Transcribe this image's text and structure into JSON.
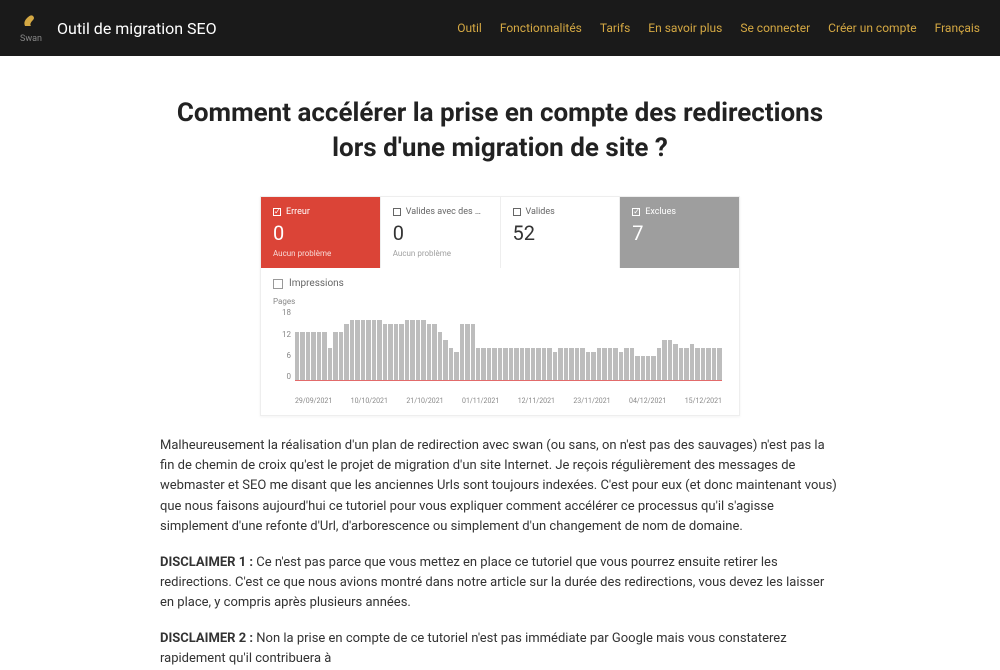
{
  "header": {
    "logo_text": "Swan",
    "site_title": "Outil de migration SEO",
    "nav": [
      "Outil",
      "Fonctionnalités",
      "Tarifs",
      "En savoir plus",
      "Se connecter",
      "Créer un compte",
      "Français"
    ]
  },
  "page_title": "Comment accélérer la prise en compte des redirections lors d'une migration de site ?",
  "chart_data": {
    "type": "bar",
    "stats": [
      {
        "label": "Erreur",
        "value": "0",
        "sub": "Aucun problème",
        "style": "red",
        "checked": true
      },
      {
        "label": "Valides avec des …",
        "value": "0",
        "sub": "Aucun problème",
        "style": "plain",
        "checked": false
      },
      {
        "label": "Valides",
        "value": "52",
        "sub": "",
        "style": "plain",
        "checked": false
      },
      {
        "label": "Exclues",
        "value": "7",
        "sub": "",
        "style": "gray",
        "checked": true
      }
    ],
    "impressions_label": "Impressions",
    "y_label": "Pages",
    "y_ticks": [
      "18",
      "12",
      "6",
      "0"
    ],
    "ylim": [
      0,
      18
    ],
    "x_ticks": [
      "29/09/2021",
      "10/10/2021",
      "21/10/2021",
      "01/11/2021",
      "12/11/2021",
      "23/11/2021",
      "04/12/2021",
      "15/12/2021"
    ],
    "values": [
      12,
      12,
      12,
      12,
      12,
      12,
      8,
      12,
      12,
      14,
      15,
      15,
      15,
      15,
      15,
      15,
      14,
      14,
      14,
      14,
      15,
      15,
      15,
      15,
      14,
      14,
      12,
      10,
      8,
      7,
      14,
      14,
      14,
      8,
      8,
      8,
      8,
      8,
      8,
      8,
      8,
      8,
      8,
      8,
      8,
      8,
      8,
      7,
      8,
      8,
      8,
      8,
      8,
      7,
      7,
      8,
      8,
      8,
      8,
      7,
      8,
      8,
      6,
      6,
      6,
      6,
      8,
      10,
      10,
      9,
      8,
      8,
      9,
      8,
      8,
      8,
      8,
      8
    ]
  },
  "paragraphs": {
    "intro": "Malheureusement la réalisation d'un plan de redirection avec swan (ou sans, on n'est pas des sauvages) n'est pas la fin de chemin de croix qu'est le projet de migration d'un site Internet. Je reçois régulièrement des messages de webmaster et SEO me disant que les anciennes Urls sont toujours indexées. C'est pour eux (et donc maintenant vous) que nous faisons aujourd'hui ce tutoriel pour vous expliquer comment accélérer ce processus qu'il s'agisse simplement d'une refonte d'Url, d'arborescence ou simplement d'un changement de nom de domaine.",
    "d1_label": "DISCLAIMER 1 :",
    "d1_text": " Ce n'est pas parce que vous mettez en place ce tutoriel que vous pourrez ensuite retirer les redirections. C'est ce que nous avions montré dans notre article sur la durée des redirections, vous devez les laisser en place, y compris après plusieurs années.",
    "d2_label": "DISCLAIMER 2 :",
    "d2_text": " Non la prise en compte de ce tutoriel n'est pas immédiate par Google mais vous constaterez rapidement qu'il contribuera à"
  },
  "colors": {
    "accent": "#d4a843",
    "error": "#db4437",
    "muted": "#9e9e9e"
  }
}
